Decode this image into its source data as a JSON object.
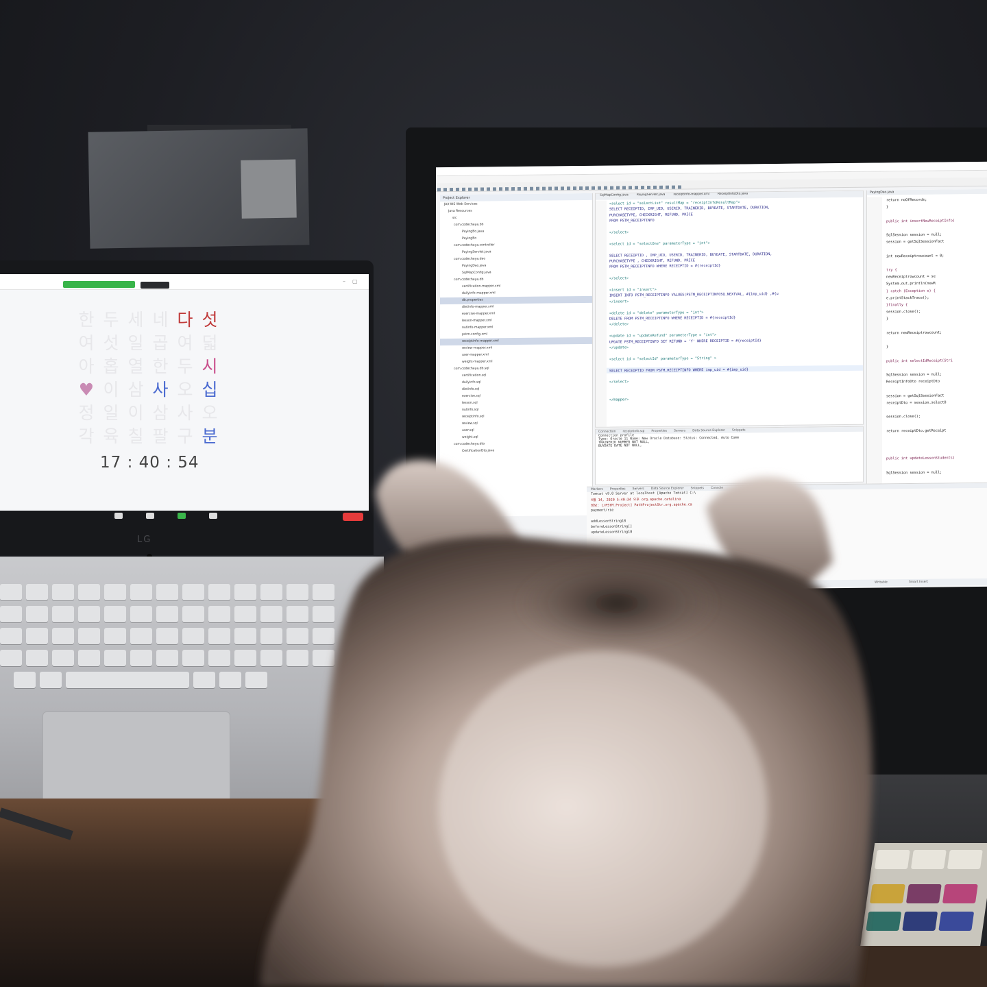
{
  "laptop": {
    "zoom_banner_left": "",
    "zoom_banner_right": "",
    "browser_tab": "",
    "word_clock_rows": [
      [
        {
          "ch": "한",
          "s": "off"
        },
        {
          "ch": "두",
          "s": "off"
        },
        {
          "ch": "세",
          "s": "off"
        },
        {
          "ch": "네",
          "s": "off"
        },
        {
          "ch": "다",
          "s": "red"
        },
        {
          "ch": "섯",
          "s": "red"
        }
      ],
      [
        {
          "ch": "여",
          "s": "off"
        },
        {
          "ch": "섯",
          "s": "off"
        },
        {
          "ch": "일",
          "s": "off"
        },
        {
          "ch": "곱",
          "s": "off"
        },
        {
          "ch": "여",
          "s": "off"
        },
        {
          "ch": "덟",
          "s": "off"
        }
      ],
      [
        {
          "ch": "아",
          "s": "off"
        },
        {
          "ch": "홉",
          "s": "off"
        },
        {
          "ch": "열",
          "s": "off"
        },
        {
          "ch": "한",
          "s": "off"
        },
        {
          "ch": "두",
          "s": "off"
        },
        {
          "ch": "시",
          "s": "pink"
        }
      ],
      [
        {
          "ch": "♥",
          "s": "heart"
        },
        {
          "ch": "이",
          "s": "off"
        },
        {
          "ch": "삼",
          "s": "off"
        },
        {
          "ch": "사",
          "s": "blue"
        },
        {
          "ch": "오",
          "s": "off"
        },
        {
          "ch": "십",
          "s": "blue"
        }
      ],
      [
        {
          "ch": "정",
          "s": "off"
        },
        {
          "ch": "일",
          "s": "off"
        },
        {
          "ch": "이",
          "s": "off"
        },
        {
          "ch": "삼",
          "s": "off"
        },
        {
          "ch": "사",
          "s": "off"
        },
        {
          "ch": "오",
          "s": "off"
        }
      ],
      [
        {
          "ch": "각",
          "s": "off"
        },
        {
          "ch": "육",
          "s": "off"
        },
        {
          "ch": "칠",
          "s": "off"
        },
        {
          "ch": "팔",
          "s": "off"
        },
        {
          "ch": "구",
          "s": "off"
        },
        {
          "ch": "분",
          "s": "blue"
        }
      ]
    ],
    "clock_time": "17 : 40 : 54",
    "zoom_controls": [
      {
        "icon": "participants-icon",
        "label": ""
      },
      {
        "icon": "chat-icon",
        "label": ""
      },
      {
        "icon": "share-screen-icon",
        "label": ""
      },
      {
        "icon": "more-icon",
        "label": ""
      }
    ],
    "end_button": "",
    "brand_logo": "LG"
  },
  "monitor": {
    "ide_title": "",
    "menu": [
      "File",
      "Edit",
      "Source",
      "Refactor",
      "Navigate",
      "Search",
      "Project",
      "Run",
      "Window",
      "Help"
    ],
    "explorer_title": "Project Explorer",
    "explorer_items": [
      {
        "t": "JAX-WS Web Services",
        "sel": false
      },
      {
        "t": "Java Resources",
        "sel": false
      },
      {
        "t": "src",
        "sel": false
      },
      {
        "t": "com.codechaya.bb",
        "sel": false
      },
      {
        "t": "PayingBo.java",
        "sel": false
      },
      {
        "t": "PayingBo",
        "sel": false
      },
      {
        "t": "com.codechaya.controller",
        "sel": false
      },
      {
        "t": "PayingServlet.java",
        "sel": false
      },
      {
        "t": "com.codechaya.dao",
        "sel": false
      },
      {
        "t": "PayingDao.java",
        "sel": false
      },
      {
        "t": "SqlMapConfig.java",
        "sel": false
      },
      {
        "t": "com.codechaya.db",
        "sel": false
      },
      {
        "t": "certification-mapper.xml",
        "sel": false
      },
      {
        "t": "dailyinfo-mapper.xml",
        "sel": false
      },
      {
        "t": "db.properties",
        "sel": true
      },
      {
        "t": "dietinfo-mapper.xml",
        "sel": false
      },
      {
        "t": "exercise-mapper.xml",
        "sel": false
      },
      {
        "t": "lesson-mapper.xml",
        "sel": false
      },
      {
        "t": "nutinfo-mapper.xml",
        "sel": false
      },
      {
        "t": "pstm.config.xml",
        "sel": false
      },
      {
        "t": "receiptinfo-mapper.xml",
        "sel": true
      },
      {
        "t": "review-mapper.xml",
        "sel": false
      },
      {
        "t": "user-mapper.xml",
        "sel": false
      },
      {
        "t": "weight-mapper.xml",
        "sel": false
      },
      {
        "t": "com.codechaya.db.sql",
        "sel": false
      },
      {
        "t": "certification.sql",
        "sel": false
      },
      {
        "t": "dailyinfo.sql",
        "sel": false
      },
      {
        "t": "dietinfo.sql",
        "sel": false
      },
      {
        "t": "exercise.sql",
        "sel": false
      },
      {
        "t": "lesson.sql",
        "sel": false
      },
      {
        "t": "nutinfo.sql",
        "sel": false
      },
      {
        "t": "receiptinfo.sql",
        "sel": false
      },
      {
        "t": "review.sql",
        "sel": false
      },
      {
        "t": "user.sql",
        "sel": false
      },
      {
        "t": "weight.sql",
        "sel": false
      },
      {
        "t": "com.codechaya.dto",
        "sel": false
      },
      {
        "t": "CertificationDto.java",
        "sel": false
      }
    ],
    "editor_tabs": [
      "SqlMapConfig.java",
      "PayingServlet.java",
      "receiptinfo-mapper.xml",
      "ReceiptInfoDto.java"
    ],
    "code": [
      {
        "t": "<select id = \"selectList\" resultMap = \"receiptInfoResultMap\">",
        "c": "tag"
      },
      {
        "t": "  SELECT RECEIPTID, IMP_UID, USERID, TRAINERID, BUYDATE, STARTDATE, DURATION,",
        "c": ""
      },
      {
        "t": "  PURCHASETYPE, CHECKRIGHT, REFUND, PRICE",
        "c": ""
      },
      {
        "t": "  FROM PSTM_RECEIPTINFO",
        "c": ""
      },
      {
        "t": "",
        "c": ""
      },
      {
        "t": "</select>",
        "c": "tag"
      },
      {
        "t": "",
        "c": ""
      },
      {
        "t": "<select id = \"selectOne\" parameterType = \"int\">",
        "c": "tag"
      },
      {
        "t": "",
        "c": ""
      },
      {
        "t": "  SELECT RECEIPTID , IMP_UID, USERID, TRAINERID, BUYDATE, STARTDATE, DURATION,",
        "c": ""
      },
      {
        "t": "  PURCHASETYPE , CHECKRIGHT, REFUND, PRICE",
        "c": ""
      },
      {
        "t": "  FROM PSTM_RECEIPTINFO WHERE RECEIPTID = #{receiptId}",
        "c": ""
      },
      {
        "t": "",
        "c": ""
      },
      {
        "t": "</select>",
        "c": "tag"
      },
      {
        "t": "",
        "c": ""
      },
      {
        "t": "<insert id = \"insert\">",
        "c": "tag"
      },
      {
        "t": "  INSERT INTO PSTM_RECEIPTINFO VALUES(PSTM_RECEIPTINFOSQ.NEXTVAL, #{imp_uid} ,#{u",
        "c": ""
      },
      {
        "t": "</insert>",
        "c": "tag"
      },
      {
        "t": "",
        "c": ""
      },
      {
        "t": "<delete id = \"delete\" parameterType = \"int\">",
        "c": "tag"
      },
      {
        "t": "  DELETE FROM PSTM_RECEIPTINFO WHERE RECEIPTID = #{receiptId}",
        "c": ""
      },
      {
        "t": "</delete>",
        "c": "tag"
      },
      {
        "t": "",
        "c": ""
      },
      {
        "t": "<update id = \"updateRefund\" parameterType = \"int\">",
        "c": "tag"
      },
      {
        "t": "  UPDATE PSTM_RECEIPTINFO SET REFUND = 'Y' WHERE RECEIPTID = #{receiptId}",
        "c": ""
      },
      {
        "t": "</update>",
        "c": "tag"
      },
      {
        "t": "",
        "c": ""
      },
      {
        "t": "<select id = \"selectId\" parameterType = \"String\" >",
        "c": "tag"
      },
      {
        "t": "",
        "c": ""
      },
      {
        "t": "  SELECT RECEIPTID FROM PSTM_RECEIPTINFO WHERE imp_uid = #{imp_uid}",
        "c": ""
      },
      {
        "t": "",
        "c": ""
      },
      {
        "t": "</select>",
        "c": "tag"
      },
      {
        "t": "",
        "c": ""
      },
      {
        "t": "",
        "c": ""
      },
      {
        "t": "</mapper>",
        "c": "tag"
      }
    ],
    "editor_lower_tabs": [
      "Design",
      "Source"
    ],
    "console_tabs": [
      "Connection",
      "receiptinfo.sql",
      "Properties",
      "Servers",
      "Data Source Explorer",
      "Snippets"
    ],
    "console_lines": [
      {
        "t": "Connection profile",
        "c": "plain"
      },
      {
        "t": "Type: Oracle 11     Name: New Oracle     Database:      Status: Connected, Auto Comm",
        "c": "plain"
      },
      {
        "t": "TRAINERID NUMBER NOT NULL,",
        "c": "plain"
      },
      {
        "t": "BUYDATE DATE NOT NULL,",
        "c": "plain"
      }
    ],
    "java_tab": "PayingDao.java",
    "java_code": [
      {
        "t": "return noOfRecords;",
        "c": ""
      },
      {
        "t": "}",
        "c": ""
      },
      {
        "t": "",
        "c": ""
      },
      {
        "t": "public int insertNewReceiptInfo(",
        "c": "kw"
      },
      {
        "t": "",
        "c": ""
      },
      {
        "t": "  SqlSession session = null;",
        "c": ""
      },
      {
        "t": "  session = getSqlSessionFact",
        "c": ""
      },
      {
        "t": "",
        "c": ""
      },
      {
        "t": "  int newReceiptrowcount = 0;",
        "c": ""
      },
      {
        "t": "",
        "c": ""
      },
      {
        "t": "  try {",
        "c": "kw"
      },
      {
        "t": "    newReceiptrowcount = se",
        "c": ""
      },
      {
        "t": "    System.out.println(newR",
        "c": ""
      },
      {
        "t": "  } catch (Exception e) {",
        "c": "kw"
      },
      {
        "t": "    e.printStackTrace();",
        "c": ""
      },
      {
        "t": "  }finally {",
        "c": "kw"
      },
      {
        "t": "    session.close();",
        "c": ""
      },
      {
        "t": "  }",
        "c": ""
      },
      {
        "t": "",
        "c": ""
      },
      {
        "t": "  return newReceiptrowcount;",
        "c": ""
      },
      {
        "t": "",
        "c": ""
      },
      {
        "t": "}",
        "c": ""
      },
      {
        "t": "",
        "c": ""
      },
      {
        "t": "public int selectIdReceipt(Stri",
        "c": "kw"
      },
      {
        "t": "",
        "c": ""
      },
      {
        "t": "  SqlSession session = null;",
        "c": ""
      },
      {
        "t": "  ReceiptInfoDto receiptDto",
        "c": ""
      },
      {
        "t": "",
        "c": ""
      },
      {
        "t": "  session = getSqlSessionFact",
        "c": ""
      },
      {
        "t": "  receiptDto = session.selectO",
        "c": ""
      },
      {
        "t": "",
        "c": ""
      },
      {
        "t": "  session.close();",
        "c": ""
      },
      {
        "t": "",
        "c": ""
      },
      {
        "t": "  return receiptDto.getReceipt",
        "c": ""
      },
      {
        "t": "",
        "c": ""
      },
      {
        "t": "",
        "c": ""
      },
      {
        "t": "",
        "c": ""
      },
      {
        "t": "public int updateLessonStudents(",
        "c": "kw"
      },
      {
        "t": "",
        "c": ""
      },
      {
        "t": "  SqlSession session = null;",
        "c": ""
      },
      {
        "t": "",
        "c": ""
      },
      {
        "t": "  session = getSqlSessionFactor",
        "c": ""
      },
      {
        "t": "",
        "c": ""
      },
      {
        "t": "  int updateLessn = 0;",
        "c": ""
      }
    ],
    "bottom_tabs": [
      "Markers",
      "Properties",
      "Servers",
      "Data Source Explorer",
      "Snippets",
      "Console"
    ],
    "bottom_console": [
      {
        "t": "Tomcat v9.0 Server at localhost [Apache Tomcat] C:\\",
        "c": "plain"
      },
      {
        "t": "4월 14, 2020 5:40:34 오후 org.apache.catalina",
        "c": "red"
      },
      {
        "t": "정보: [/PSTM_Project] PathProjectStr.org.apache.ca",
        "c": "red"
      },
      {
        "t": "payment/rie",
        "c": "plain"
      },
      {
        "t": "",
        "c": "plain"
      },
      {
        "t": "addLessonString18",
        "c": "plain"
      },
      {
        "t": "beforeLessonString[]",
        "c": "plain"
      },
      {
        "t": "updateLessonString18",
        "c": "plain"
      }
    ],
    "status_items": [
      "Writable",
      "Smart Insert"
    ]
  },
  "colors": {
    "word_clock_red": "#c03a3a",
    "word_clock_pink": "#c94f8c",
    "word_clock_blue": "#4a6ad0",
    "zoom_green": "#38b449",
    "zoom_end_red": "#e63b3b"
  }
}
